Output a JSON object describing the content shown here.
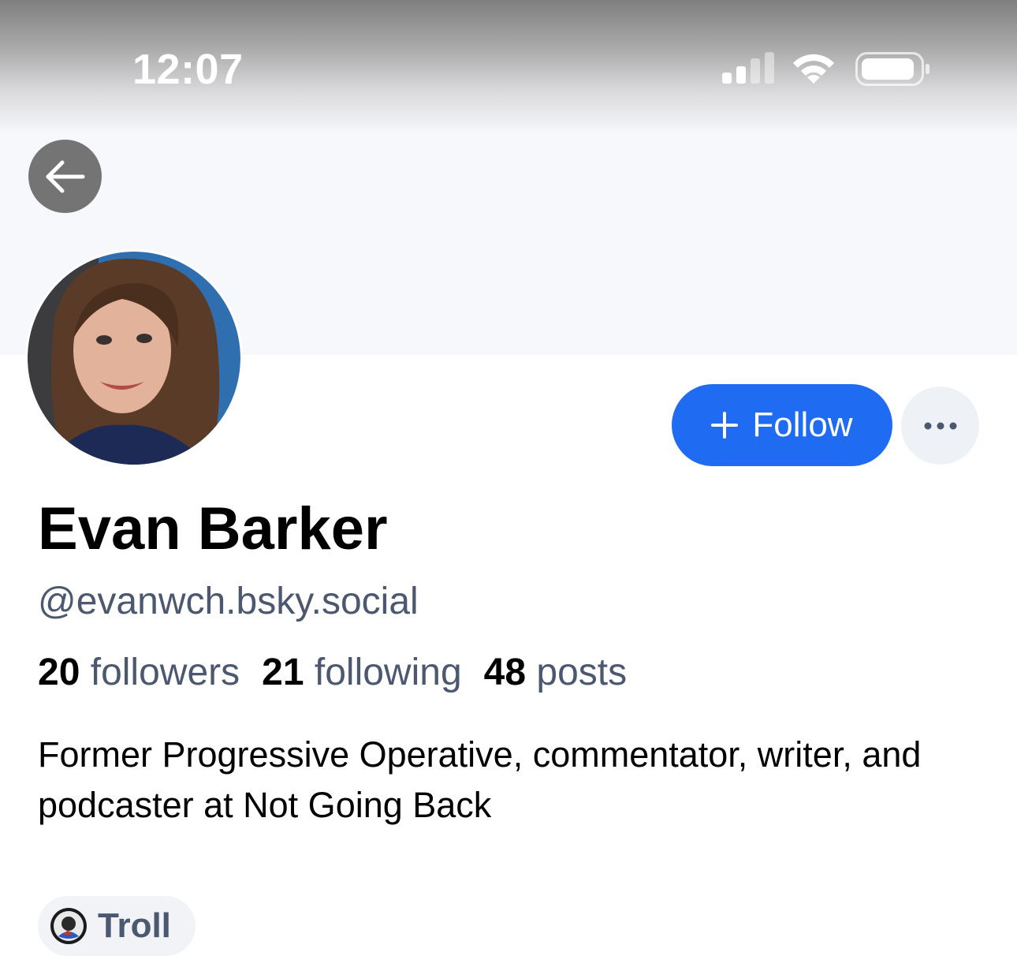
{
  "status_bar": {
    "time": "12:07",
    "icons": [
      "cellular-signal-icon",
      "wifi-icon",
      "battery-icon"
    ]
  },
  "nav": {
    "back_icon": "arrow-left-icon"
  },
  "profile": {
    "display_name": "Evan Barker",
    "handle": "@evanwch.bsky.social",
    "stats": [
      {
        "count": "20",
        "label": "followers"
      },
      {
        "count": "21",
        "label": "following"
      },
      {
        "count": "48",
        "label": "posts"
      }
    ],
    "bio": "Former Progressive Operative, commentator, writer, and podcaster at Not Going Back"
  },
  "actions": {
    "follow_label": "Follow",
    "more_icon": "ellipsis-icon"
  },
  "labels": [
    {
      "text": "Troll",
      "icon": "labeler-avatar-icon"
    }
  ],
  "colors": {
    "accent": "#1f6cf2",
    "secondary_text": "#4b5870",
    "banner": "#f7f8fb"
  }
}
